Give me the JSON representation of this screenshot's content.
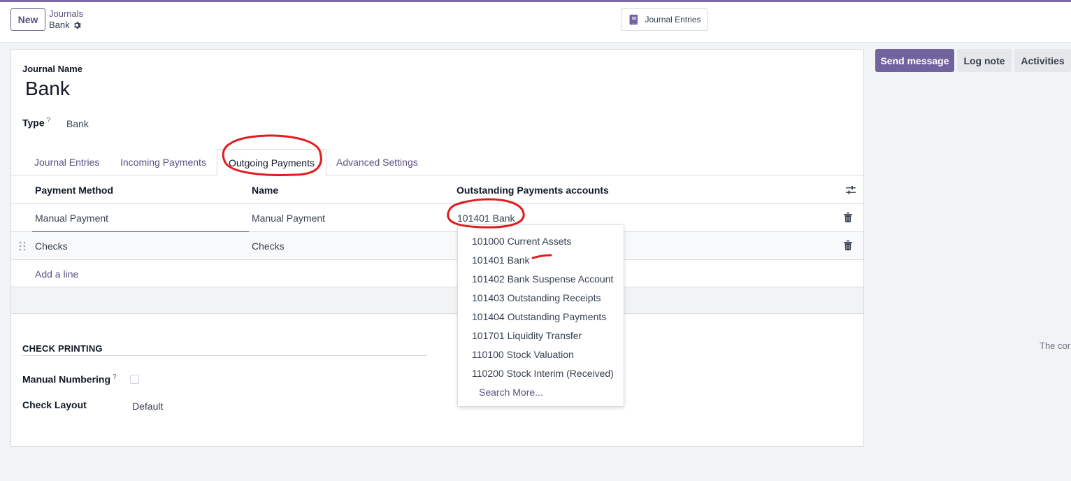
{
  "control_panel": {
    "new_label": "New",
    "breadcrumb_parent": "Journals",
    "breadcrumb_current": "Bank",
    "smart_button_label": "Journal Entries"
  },
  "form": {
    "journal_name_label": "Journal Name",
    "journal_name_value": "Bank",
    "type_label": "Type",
    "type_help": "?",
    "type_value": "Bank",
    "tabs": [
      {
        "label": "Journal Entries"
      },
      {
        "label": "Incoming Payments"
      },
      {
        "label": "Outgoing Payments",
        "active": true
      },
      {
        "label": "Advanced Settings"
      }
    ],
    "table": {
      "headers": [
        "Payment Method",
        "Name",
        "Outstanding Payments accounts"
      ],
      "rows": [
        {
          "method": "Manual Payment",
          "name": "Manual Payment",
          "account": "101401 Bank"
        },
        {
          "method": "Checks",
          "name": "Checks",
          "account": ""
        }
      ],
      "add_line": "Add a line"
    },
    "check_printing": {
      "title": "CHECK PRINTING",
      "manual_numbering_label": "Manual Numbering",
      "manual_numbering_help": "?",
      "manual_numbering_checked": false,
      "check_layout_label": "Check Layout",
      "check_layout_value": "Default"
    }
  },
  "dropdown": {
    "items": [
      "101000 Current Assets",
      "101401 Bank",
      "101402 Bank Suspense Account",
      "101403 Outstanding Receipts",
      "101404 Outstanding Payments",
      "101701 Liquidity Transfer",
      "110100 Stock Valuation",
      "110200 Stock Interim (Received)"
    ],
    "search_more": "Search More..."
  },
  "chatter": {
    "send_message": "Send message",
    "log_note": "Log note",
    "activities": "Activities",
    "partial_text": "The cor"
  },
  "colors": {
    "accent": "#5c4f84",
    "primary_button": "#71639e",
    "annotation": "#e11d1d"
  }
}
